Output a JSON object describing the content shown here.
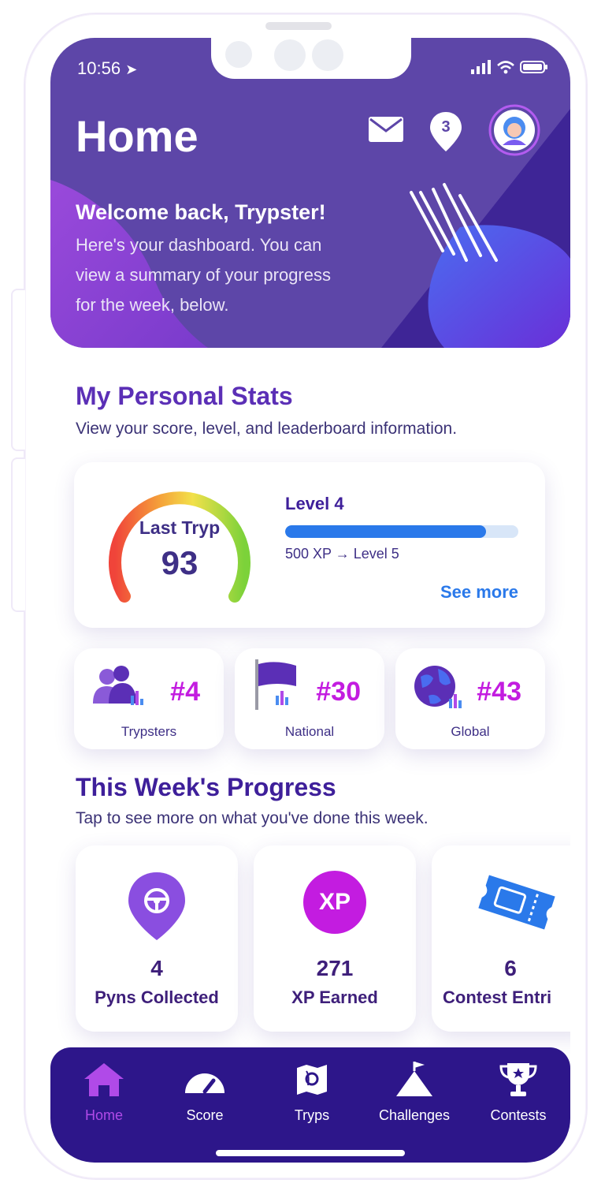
{
  "status_bar": {
    "time": "10:56"
  },
  "header": {
    "title": "Home",
    "notification_count": "3",
    "welcome_title": "Welcome back, Trypster!",
    "welcome_body": "Here's your dashboard. You can view a summary of your progress for the week, below."
  },
  "personal_stats": {
    "title": "My Personal Stats",
    "subtitle": "View your score, level, and leaderboard information.",
    "gauge_label": "Last Tryp",
    "gauge_value": "93",
    "level_title": "Level 4",
    "level_progress": 0.86,
    "level_next": "500 XP → Level 5",
    "see_more": "See more"
  },
  "rankings": [
    {
      "value": "#4",
      "label": "Trypsters",
      "icon": "group-icon"
    },
    {
      "value": "#30",
      "label": "National",
      "icon": "flag-icon"
    },
    {
      "value": "#43",
      "label": "Global",
      "icon": "globe-icon"
    }
  ],
  "weekly_progress": {
    "title": "This Week's Progress",
    "subtitle": "Tap to see more on what you've done this week.",
    "cards": [
      {
        "value": "4",
        "label": "Pyns Collected",
        "icon": "pin-steering-wheel-icon"
      },
      {
        "value": "271",
        "label": "XP Earned",
        "icon": "xp-badge-icon",
        "icon_text": "XP"
      },
      {
        "value": "6",
        "label": "Contest Entri",
        "icon": "ticket-icon"
      }
    ]
  },
  "tabbar": {
    "items": [
      {
        "label": "Home",
        "icon": "home-icon",
        "active": true
      },
      {
        "label": "Score",
        "icon": "speedometer-icon",
        "active": false
      },
      {
        "label": "Tryps",
        "icon": "map-icon",
        "active": false
      },
      {
        "label": "Challenges",
        "icon": "mountain-flag-icon",
        "active": false
      },
      {
        "label": "Contests",
        "icon": "trophy-icon",
        "active": false
      }
    ]
  },
  "colors": {
    "header_bg": "#5d46a8",
    "accent_purple": "#5b2fb6",
    "rank_magenta": "#c31ce0",
    "link_blue": "#2a79ea",
    "tabbar_bg": "#2d168a"
  }
}
